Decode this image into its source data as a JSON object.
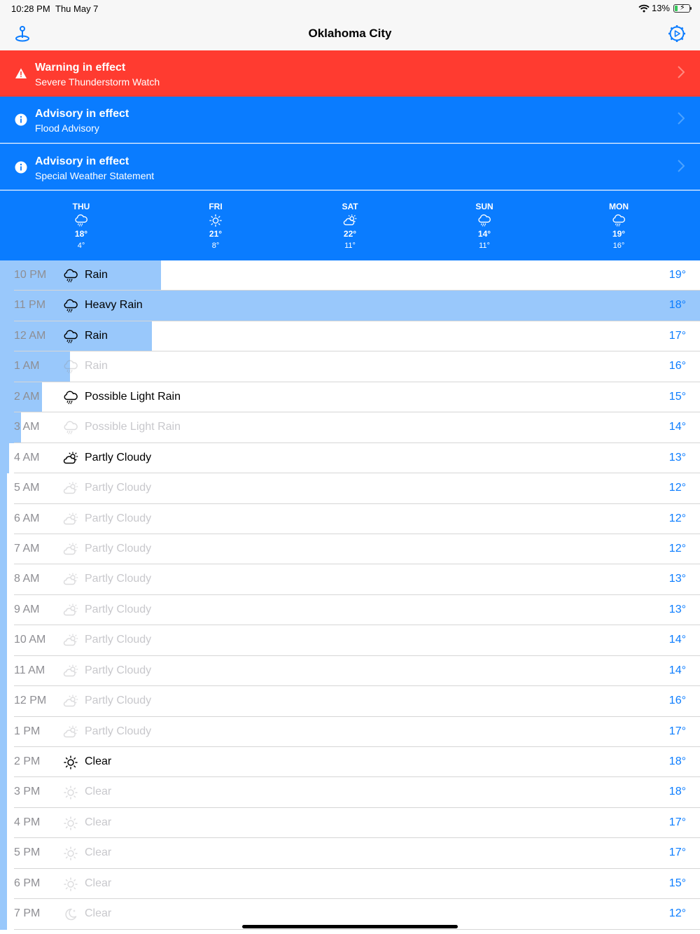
{
  "status": {
    "time": "10:28 PM",
    "date": "Thu May 7",
    "battery": "13%"
  },
  "nav": {
    "title": "Oklahoma City"
  },
  "alerts": [
    {
      "title": "Warning in effect",
      "subtitle": "Severe Thunderstorm Watch",
      "color": "#ff3b30"
    },
    {
      "title": "Advisory in effect",
      "subtitle": "Flood Advisory",
      "color": "#0a7cff"
    },
    {
      "title": "Advisory in effect",
      "subtitle": "Special Weather Statement",
      "color": "#0a7cff"
    }
  ],
  "days": [
    {
      "name": "THU",
      "hi": "18°",
      "lo": "4°",
      "icon": "rain"
    },
    {
      "name": "FRI",
      "hi": "21°",
      "lo": "8°",
      "icon": "clear"
    },
    {
      "name": "SAT",
      "hi": "22°",
      "lo": "11°",
      "icon": "partly-cloudy"
    },
    {
      "name": "SUN",
      "hi": "14°",
      "lo": "11°",
      "icon": "rain"
    },
    {
      "name": "MON",
      "hi": "19°",
      "lo": "16°",
      "icon": "rain"
    }
  ],
  "hours": [
    {
      "time": "10 PM",
      "cond": "Rain",
      "temp": "19°",
      "icon": "rain",
      "dim": false,
      "precip": 0.23
    },
    {
      "time": "11 PM",
      "cond": "Heavy Rain",
      "temp": "18°",
      "icon": "rain",
      "dim": false,
      "precip": 1.0
    },
    {
      "time": "12 AM",
      "cond": "Rain",
      "temp": "17°",
      "icon": "rain",
      "dim": false,
      "precip": 0.217
    },
    {
      "time": "1 AM",
      "cond": "Rain",
      "temp": "16°",
      "icon": "rain",
      "dim": true,
      "precip": 0.1
    },
    {
      "time": "2 AM",
      "cond": "Possible Light Rain",
      "temp": "15°",
      "icon": "rain",
      "dim": false,
      "precip": 0.06
    },
    {
      "time": "3 AM",
      "cond": "Possible Light Rain",
      "temp": "14°",
      "icon": "rain",
      "dim": true,
      "precip": 0.03
    },
    {
      "time": "4 AM",
      "cond": "Partly Cloudy",
      "temp": "13°",
      "icon": "partly-cloudy",
      "dim": false,
      "precip": 0.013
    },
    {
      "time": "5 AM",
      "cond": "Partly Cloudy",
      "temp": "12°",
      "icon": "partly-cloudy",
      "dim": true,
      "precip": 0.01
    },
    {
      "time": "6 AM",
      "cond": "Partly Cloudy",
      "temp": "12°",
      "icon": "partly-cloudy",
      "dim": true,
      "precip": 0.01
    },
    {
      "time": "7 AM",
      "cond": "Partly Cloudy",
      "temp": "12°",
      "icon": "partly-cloudy",
      "dim": true,
      "precip": 0.01
    },
    {
      "time": "8 AM",
      "cond": "Partly Cloudy",
      "temp": "13°",
      "icon": "partly-cloudy",
      "dim": true,
      "precip": 0.01
    },
    {
      "time": "9 AM",
      "cond": "Partly Cloudy",
      "temp": "13°",
      "icon": "partly-cloudy",
      "dim": true,
      "precip": 0.01
    },
    {
      "time": "10 AM",
      "cond": "Partly Cloudy",
      "temp": "14°",
      "icon": "partly-cloudy",
      "dim": true,
      "precip": 0.01
    },
    {
      "time": "11 AM",
      "cond": "Partly Cloudy",
      "temp": "14°",
      "icon": "partly-cloudy",
      "dim": true,
      "precip": 0.01
    },
    {
      "time": "12 PM",
      "cond": "Partly Cloudy",
      "temp": "16°",
      "icon": "partly-cloudy",
      "dim": true,
      "precip": 0.01
    },
    {
      "time": "1 PM",
      "cond": "Partly Cloudy",
      "temp": "17°",
      "icon": "partly-cloudy",
      "dim": true,
      "precip": 0.01
    },
    {
      "time": "2 PM",
      "cond": "Clear",
      "temp": "18°",
      "icon": "clear",
      "dim": false,
      "precip": 0.01
    },
    {
      "time": "3 PM",
      "cond": "Clear",
      "temp": "18°",
      "icon": "clear",
      "dim": true,
      "precip": 0.01
    },
    {
      "time": "4 PM",
      "cond": "Clear",
      "temp": "17°",
      "icon": "clear",
      "dim": true,
      "precip": 0.01
    },
    {
      "time": "5 PM",
      "cond": "Clear",
      "temp": "17°",
      "icon": "clear",
      "dim": true,
      "precip": 0.01
    },
    {
      "time": "6 PM",
      "cond": "Clear",
      "temp": "15°",
      "icon": "clear",
      "dim": true,
      "precip": 0.01
    },
    {
      "time": "7 PM",
      "cond": "Clear",
      "temp": "12°",
      "icon": "clear-night",
      "dim": true,
      "precip": 0.01
    }
  ]
}
